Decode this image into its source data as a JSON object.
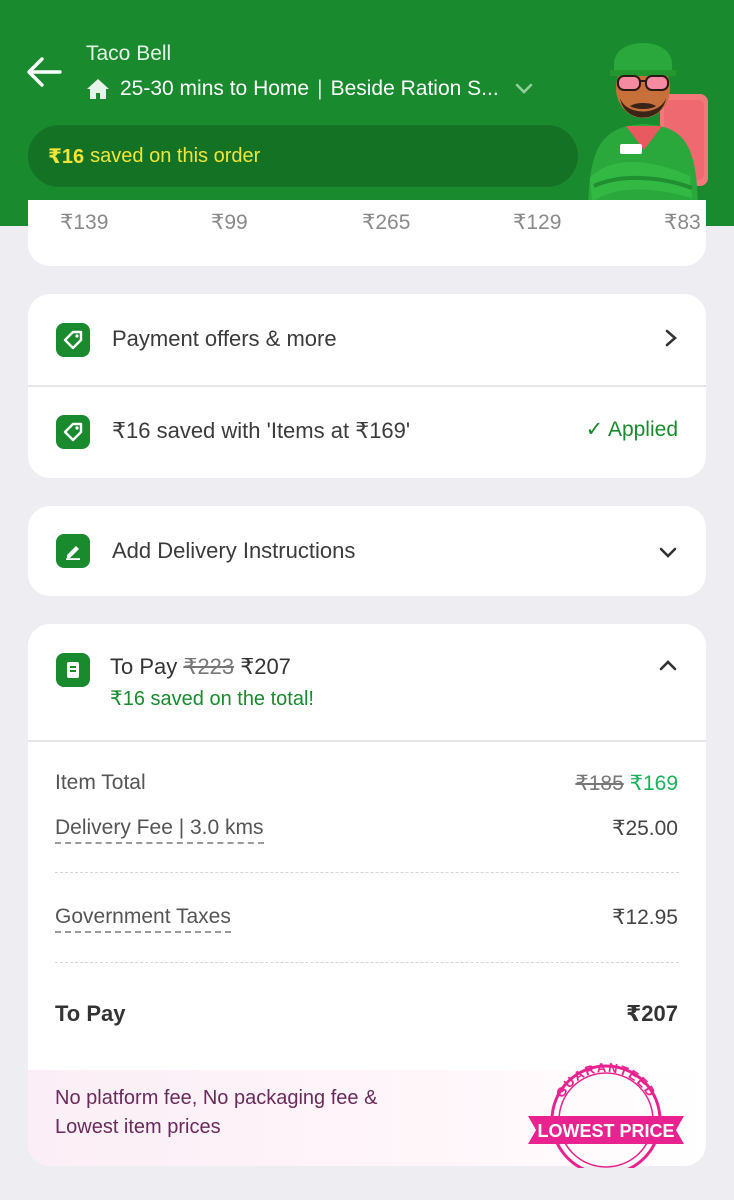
{
  "header": {
    "restaurant": "Taco Bell",
    "eta": "25-30 mins to Home",
    "separator": "|",
    "address": "Beside Ration S...",
    "saved_amount": "₹16",
    "saved_text": "saved on this order"
  },
  "prices": [
    "₹139",
    "₹99",
    "₹265",
    "₹129",
    "₹83"
  ],
  "offers": {
    "payment_offers_label": "Payment offers & more",
    "applied_offer_text": "₹16 saved with 'Items at ₹169'",
    "applied_label": "✓ Applied"
  },
  "delivery": {
    "instructions_label": "Add Delivery Instructions"
  },
  "to_pay": {
    "label": "To Pay",
    "original": "₹223",
    "final": "₹207",
    "saved_note": "₹16 saved on the total!"
  },
  "bill": {
    "item_total_label": "Item Total",
    "item_total_original": "₹185",
    "item_total_final": "₹169",
    "delivery_fee_label": "Delivery Fee | 3.0 kms",
    "delivery_fee_value": "₹25.00",
    "taxes_label": "Government Taxes",
    "taxes_value": "₹12.95",
    "to_pay_label": "To Pay",
    "to_pay_value": "₹207"
  },
  "promo": {
    "line1": "No platform fee, No packaging fee &",
    "line2": "Lowest item prices",
    "stamp_top": "GUARANTEED",
    "stamp_banner": "LOWEST PRICE"
  },
  "colors": {
    "brand_green": "#1a8a2e",
    "highlight_yellow": "#f2e53a",
    "savings_green": "#1bb25a",
    "stamp_pink": "#e8238f"
  }
}
